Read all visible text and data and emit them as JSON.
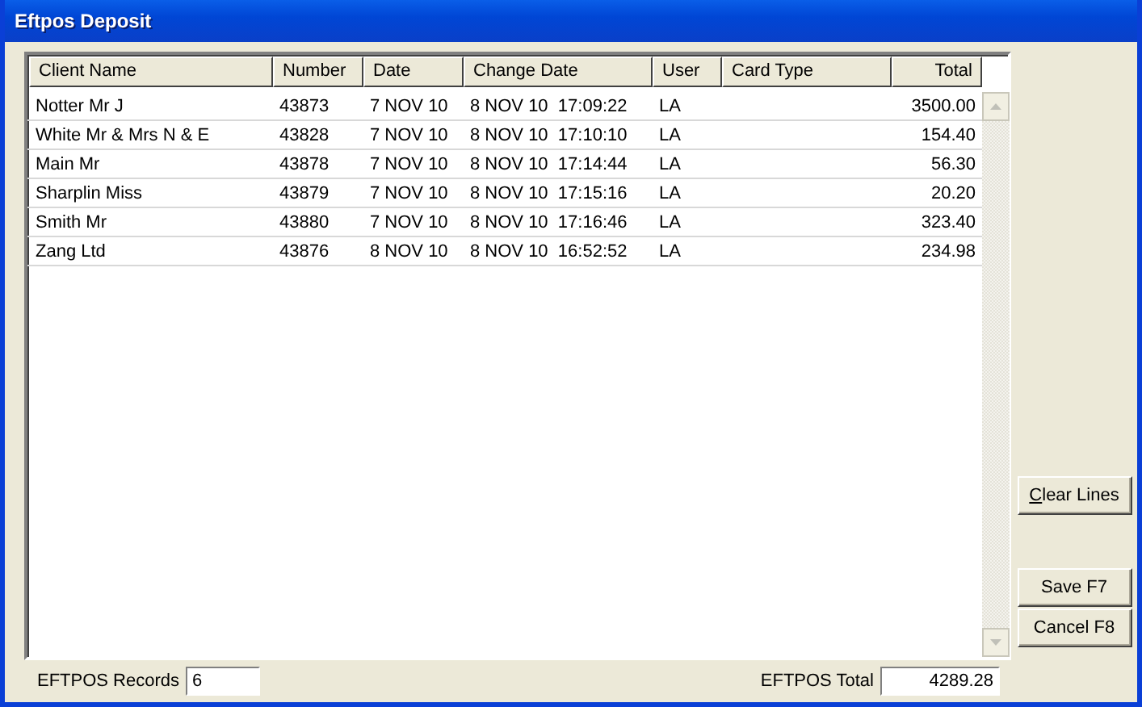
{
  "window": {
    "title": "Eftpos Deposit"
  },
  "table": {
    "columns": [
      "Client Name",
      "Number",
      "Date",
      "Change Date",
      "User",
      "Card Type",
      "Total"
    ],
    "rows": [
      [
        "Notter Mr J",
        "43873",
        "7 NOV 10",
        "8 NOV 10  17:09:22",
        "LA",
        "",
        "3500.00"
      ],
      [
        "White Mr & Mrs N & E",
        "43828",
        "7 NOV 10",
        "8 NOV 10  17:10:10",
        "LA",
        "",
        "154.40"
      ],
      [
        "Main Mr",
        "43878",
        "7 NOV 10",
        "8 NOV 10  17:14:44",
        "LA",
        "",
        "56.30"
      ],
      [
        "Sharplin Miss",
        "43879",
        "7 NOV 10",
        "8 NOV 10  17:15:16",
        "LA",
        "",
        "20.20"
      ],
      [
        "Smith Mr",
        "43880",
        "7 NOV 10",
        "8 NOV 10  17:16:46",
        "LA",
        "",
        "323.40"
      ],
      [
        "Zang Ltd",
        "43876",
        "8 NOV 10",
        "8 NOV 10  16:52:52",
        "LA",
        "",
        "234.98"
      ]
    ]
  },
  "buttons": {
    "clear": "Clear Lines",
    "save": "Save F7",
    "cancel": "Cancel F8"
  },
  "footer": {
    "records_label": "EFTPOS Records",
    "records": "6",
    "total_label": "EFTPOS Total",
    "total": "4289.28"
  }
}
